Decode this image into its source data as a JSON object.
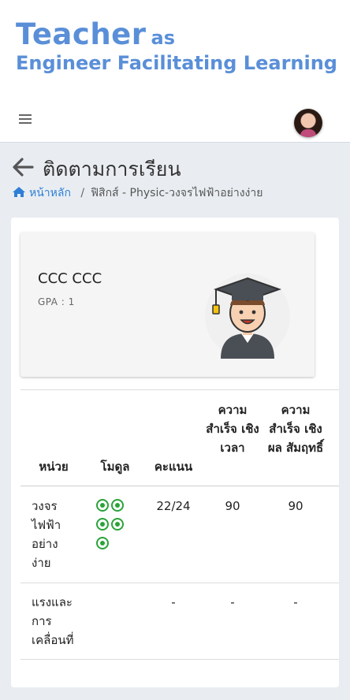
{
  "banner": {
    "word_teacher": "Teacher",
    "word_as": "as",
    "line2": "Engineer Facilitating Learning"
  },
  "topbar": {
    "menu_icon": "hamburger-menu-icon",
    "avatar": "user-avatar"
  },
  "page": {
    "title": "ติดตามการเรียน",
    "back_icon": "arrow-left-icon"
  },
  "breadcrumb": {
    "home_icon": "home-icon",
    "home_label": "หน้าหลัก",
    "separator": "/",
    "current": "ฟิสิกส์ - Physic-วงจรไฟฟ้าอย่างง่าย"
  },
  "student": {
    "name": "CCC CCC",
    "gpa": "GPA : 1",
    "avatar_icon": "graduate-student-icon"
  },
  "table": {
    "headers": {
      "unit": "หน่วย",
      "module": "โมดูล",
      "score": "คะแนน",
      "time_success": "ความ สำเร็จ เชิง เวลา",
      "result_success": "ความ สำเร็จ เชิงผล สัมฤทธิ์"
    },
    "rows": [
      {
        "unit": "วงจร ไฟฟ้า อย่าง ง่าย",
        "module_count": 5,
        "module_icon": "radio-checked-icon",
        "score": "22/24",
        "time_success": "90",
        "result_success": "90"
      },
      {
        "unit": "แรงและ การ เคลื่อนที่",
        "module_count": 0,
        "score": "-",
        "time_success": "-",
        "result_success": "-"
      }
    ]
  },
  "colors": {
    "brand_blue": "#5a8fd8",
    "link_blue": "#2f7fd6",
    "module_green": "#2aa33a",
    "page_bg": "#e9edf2"
  }
}
